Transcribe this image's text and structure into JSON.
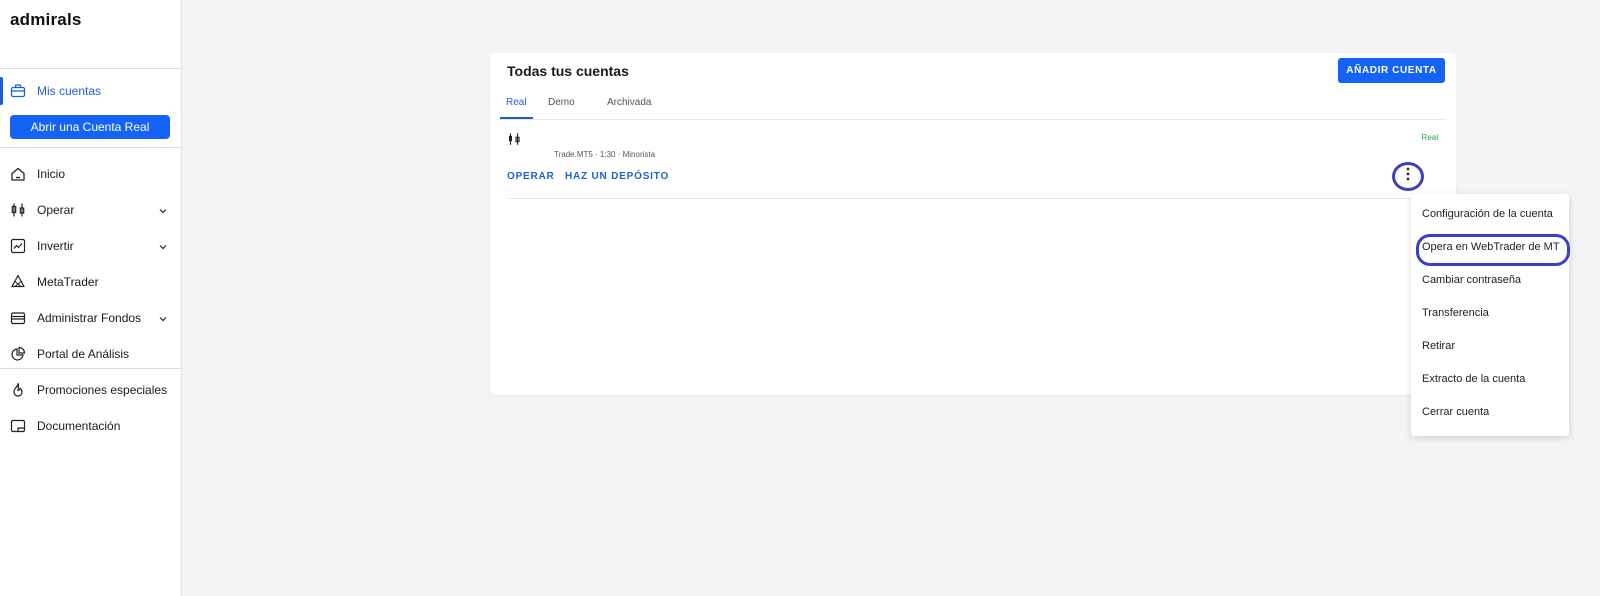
{
  "sidebar": {
    "logo": "admirals",
    "my_accounts": "Mis cuentas",
    "open_real_account": "Abrir una Cuenta Real",
    "items": [
      {
        "label": "Inicio"
      },
      {
        "label": "Operar"
      },
      {
        "label": "Invertir"
      },
      {
        "label": "MetaTrader"
      },
      {
        "label": "Administrar Fondos"
      },
      {
        "label": "Portal de Análisis"
      },
      {
        "label": "Promociones especiales"
      },
      {
        "label": "Documentación"
      }
    ],
    "accent_color": "#1f5fd6"
  },
  "card": {
    "title": "Todas tus cuentas",
    "add_account": "AÑADIR CUENTA",
    "tabs": [
      {
        "label": "Real",
        "active": true
      },
      {
        "label": "Demo",
        "active": false
      },
      {
        "label": "Archivada",
        "active": false
      }
    ],
    "account": {
      "meta": "Trade.MT5 · 1:30 · Minorista",
      "type_badge": "Real",
      "actions": [
        "OPERAR",
        "HAZ UN DEPÓSITO"
      ]
    }
  },
  "menu": {
    "items": [
      {
        "label": "Configuración de la cuenta"
      },
      {
        "label": "Opera en WebTrader de MT",
        "highlighted": true
      },
      {
        "label": "Cambiar contraseña"
      },
      {
        "label": "Transferencia"
      },
      {
        "label": "Retirar"
      },
      {
        "label": "Extracto de la cuenta"
      },
      {
        "label": "Cerrar cuenta"
      }
    ]
  },
  "colors": {
    "primary_button": "#1463f5",
    "highlight_ring": "#3a3fc4",
    "real_badge": "#2ea84a",
    "background": "#f4f4f4"
  }
}
